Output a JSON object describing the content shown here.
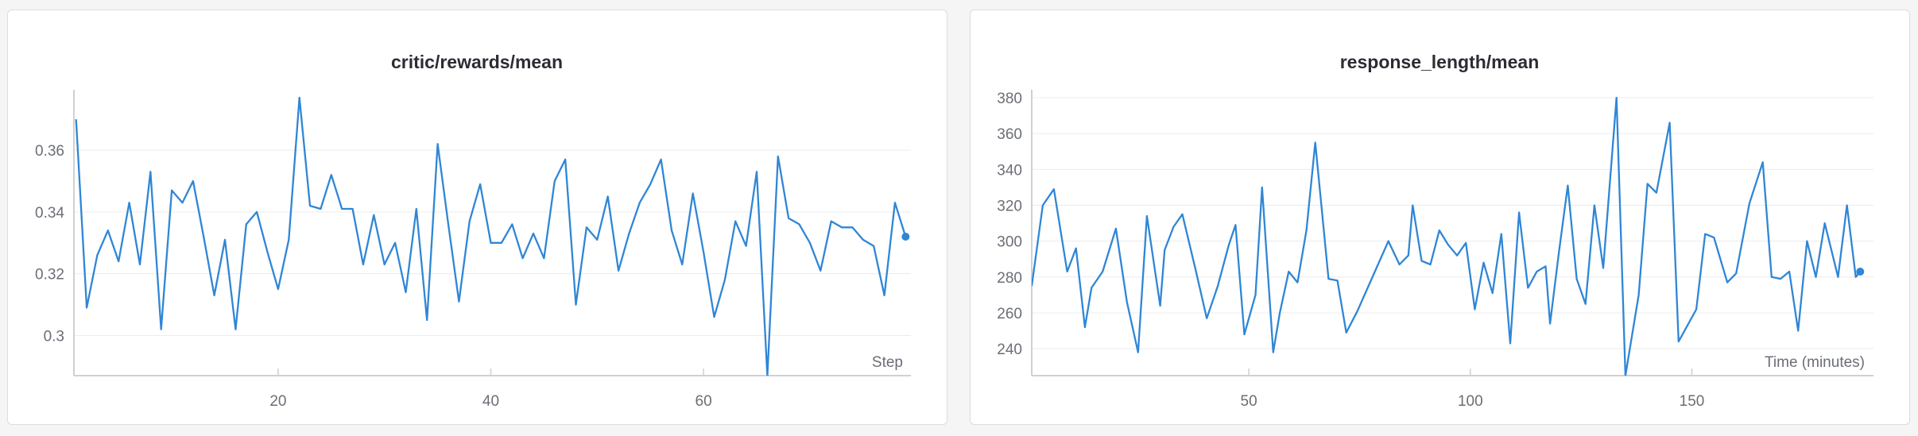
{
  "colors": {
    "line": "#2f86d6",
    "grid": "#ececee",
    "axis": "#cfd0d3"
  },
  "chart_data": [
    {
      "type": "line",
      "title": "critic/rewards/mean",
      "xlabel": "Step",
      "ylabel": "",
      "xlim": [
        0.8,
        79.5
      ],
      "ylim": [
        0.287,
        0.377
      ],
      "xticks": [
        20,
        40,
        60
      ],
      "yticks": [
        0.3,
        0.32,
        0.34,
        0.36
      ],
      "ytick_labels": [
        "0.3",
        "0.32",
        "0.34",
        "0.36"
      ],
      "grid": true,
      "series": [
        {
          "x": [
            1,
            2,
            3,
            4,
            5,
            6,
            7,
            8,
            9,
            10,
            11,
            12,
            13,
            14,
            15,
            16,
            17,
            18,
            19,
            20,
            21,
            22,
            23,
            24,
            25,
            26,
            27,
            28,
            29,
            30,
            31,
            32,
            33,
            34,
            35,
            36,
            37,
            38,
            39,
            40,
            41,
            42,
            43,
            44,
            45,
            46,
            47,
            48,
            49,
            50,
            51,
            52,
            53,
            54,
            55,
            56,
            57,
            58,
            59,
            60,
            61,
            62,
            63,
            64,
            65,
            66,
            67,
            68,
            69,
            70,
            71,
            72,
            73,
            74,
            75,
            76,
            77,
            78,
            79
          ],
          "y": [
            0.37,
            0.309,
            0.326,
            0.334,
            0.324,
            0.343,
            0.323,
            0.353,
            0.302,
            0.347,
            0.343,
            0.35,
            0.332,
            0.313,
            0.331,
            0.302,
            0.336,
            0.34,
            0.327,
            0.315,
            0.331,
            0.377,
            0.342,
            0.341,
            0.352,
            0.341,
            0.341,
            0.323,
            0.339,
            0.323,
            0.33,
            0.314,
            0.341,
            0.305,
            0.362,
            0.336,
            0.311,
            0.337,
            0.349,
            0.33,
            0.33,
            0.336,
            0.325,
            0.333,
            0.325,
            0.35,
            0.357,
            0.31,
            0.335,
            0.331,
            0.345,
            0.321,
            0.333,
            0.343,
            0.349,
            0.357,
            0.334,
            0.323,
            0.346,
            0.327,
            0.306,
            0.318,
            0.337,
            0.329,
            0.353,
            0.287,
            0.358,
            0.338,
            0.336,
            0.33,
            0.321,
            0.337,
            0.335,
            0.335,
            0.331,
            0.329,
            0.313,
            0.343,
            0.332
          ]
        }
      ]
    },
    {
      "type": "line",
      "title": "response_length/mean",
      "xlabel": "Time (minutes)",
      "ylabel": "",
      "xlim": [
        1,
        191
      ],
      "ylim": [
        225,
        380
      ],
      "xticks": [
        50,
        100,
        150
      ],
      "yticks": [
        240,
        260,
        280,
        300,
        320,
        340,
        360,
        380
      ],
      "ytick_labels": [
        "240",
        "260",
        "280",
        "300",
        "320",
        "340",
        "360",
        "380"
      ],
      "grid": true,
      "series": [
        {
          "x": [
            1,
            3.5,
            6,
            9,
            11,
            13,
            14.5,
            17,
            20,
            22.5,
            25,
            27,
            30,
            31,
            33,
            35,
            38,
            40.5,
            43,
            45.5,
            47,
            49,
            51.5,
            53,
            55.5,
            57,
            59,
            61,
            63,
            65,
            68,
            70,
            72,
            74.5,
            81.5,
            84,
            86,
            87,
            89,
            91,
            93,
            95,
            97,
            99,
            101,
            103,
            105,
            107,
            109,
            111,
            113,
            115,
            117,
            118,
            120,
            122,
            124,
            126,
            128,
            130,
            133,
            135,
            138,
            140,
            142,
            145,
            147,
            151,
            153,
            155,
            158,
            160,
            163,
            166,
            168,
            170,
            172,
            174,
            176,
            178,
            180,
            183,
            185,
            187,
            188
          ],
          "y": [
            275,
            320,
            329,
            283,
            296,
            252,
            274,
            283,
            307,
            266,
            238,
            314,
            264,
            295,
            308,
            315,
            284,
            257,
            275,
            298,
            309,
            248,
            270,
            330,
            238,
            260,
            283,
            277,
            306,
            355,
            279,
            278,
            249,
            261,
            300,
            287,
            292,
            320,
            289,
            287,
            306,
            298,
            292,
            299,
            262,
            288,
            271,
            304,
            243,
            316,
            274,
            283,
            286,
            254,
            294,
            331,
            279,
            265,
            320,
            285,
            380,
            225,
            270,
            332,
            327,
            366,
            244,
            262,
            304,
            302,
            277,
            282,
            321,
            344,
            280,
            279,
            283,
            250,
            300,
            280,
            310,
            280,
            320,
            280,
            283
          ]
        }
      ]
    }
  ]
}
